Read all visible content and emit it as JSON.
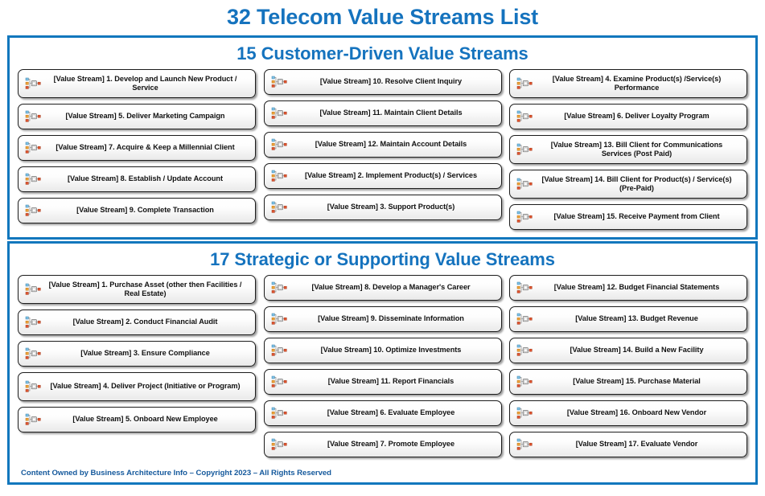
{
  "title": "32 Telecom Value Streams List",
  "sections": [
    {
      "heading": "15 Customer-Driven Value Streams",
      "columns": [
        {
          "items": [
            {
              "label": "[Value Stream] 1. Develop and Launch New Product / Service",
              "lines": 2
            },
            {
              "label": "[Value Stream] 5. Deliver Marketing Campaign",
              "lines": 1
            },
            {
              "label": "[Value Stream] 7. Acquire & Keep a Millennial Client",
              "lines": 1
            },
            {
              "label": "[Value Stream] 8. Establish / Update Account",
              "lines": 1
            },
            {
              "label": "[Value Stream] 9. Complete Transaction",
              "lines": 1
            }
          ]
        },
        {
          "items": [
            {
              "label": "[Value Stream] 10. Resolve Client Inquiry",
              "lines": 1
            },
            {
              "label": "[Value Stream] 11. Maintain Client Details",
              "lines": 1
            },
            {
              "label": "[Value Stream] 12. Maintain Account Details",
              "lines": 1
            },
            {
              "label": "[Value Stream] 2. Implement Product(s) / Services",
              "lines": 1
            },
            {
              "label": "[Value Stream] 3. Support Product(s)",
              "lines": 1
            }
          ]
        },
        {
          "items": [
            {
              "label": "[Value Stream] 4. Examine Product(s) /Service(s) Performance",
              "lines": 2
            },
            {
              "label": "[Value Stream] 6. Deliver Loyalty Program",
              "lines": 1
            },
            {
              "label": "[Value Stream] 13. Bill Client for Communications Services (Post Paid)",
              "lines": 2
            },
            {
              "label": "[Value Stream] 14. Bill Client for Product(s) / Service(s) (Pre-Paid)",
              "lines": 2
            },
            {
              "label": "[Value Stream] 15. Receive Payment from Client",
              "lines": 1
            }
          ]
        }
      ]
    },
    {
      "heading": "17 Strategic or Supporting Value Streams",
      "columns": [
        {
          "items": [
            {
              "label": "[Value Stream] 1. Purchase Asset (other then Facilities / Real Estate)",
              "lines": 2
            },
            {
              "label": "[Value Stream] 2. Conduct Financial Audit",
              "lines": 1
            },
            {
              "label": "[Value Stream] 3. Ensure Compliance",
              "lines": 1
            },
            {
              "label": "[Value Stream] 4. Deliver Project (Initiative or Program)",
              "lines": 2
            },
            {
              "label": "[Value Stream] 5. Onboard New Employee",
              "lines": 1
            }
          ]
        },
        {
          "items": [
            {
              "label": "[Value Stream] 8. Develop a Manager's Career",
              "lines": 1
            },
            {
              "label": "[Value Stream] 9. Disseminate Information",
              "lines": 1
            },
            {
              "label": "[Value Stream] 10. Optimize Investments",
              "lines": 1
            },
            {
              "label": "[Value Stream] 11. Report Financials",
              "lines": 1
            },
            {
              "label": "[Value Stream] 6. Evaluate Employee",
              "lines": 1
            },
            {
              "label": "[Value Stream] 7. Promote Employee",
              "lines": 1
            }
          ]
        },
        {
          "items": [
            {
              "label": "[Value Stream] 12. Budget Financial Statements",
              "lines": 1
            },
            {
              "label": "[Value Stream] 13. Budget Revenue",
              "lines": 1
            },
            {
              "label": "[Value Stream] 14. Build a New Facility",
              "lines": 1
            },
            {
              "label": "[Value Stream] 15. Purchase Material",
              "lines": 1
            },
            {
              "label": "[Value Stream] 16. Onboard New Vendor",
              "lines": 1
            },
            {
              "label": "[Value Stream] 17. Evaluate Vendor",
              "lines": 1
            }
          ]
        }
      ]
    }
  ],
  "footer": "Content Owned by Business Architecture Info  – Copyright 2023  – All Rights Reserved",
  "icon_name": "value-stream-icon",
  "colors": {
    "title_blue": "#1573be",
    "border_blue": "#1277bd",
    "footer_blue": "#15599c",
    "box_border": "#1c1c1c"
  }
}
